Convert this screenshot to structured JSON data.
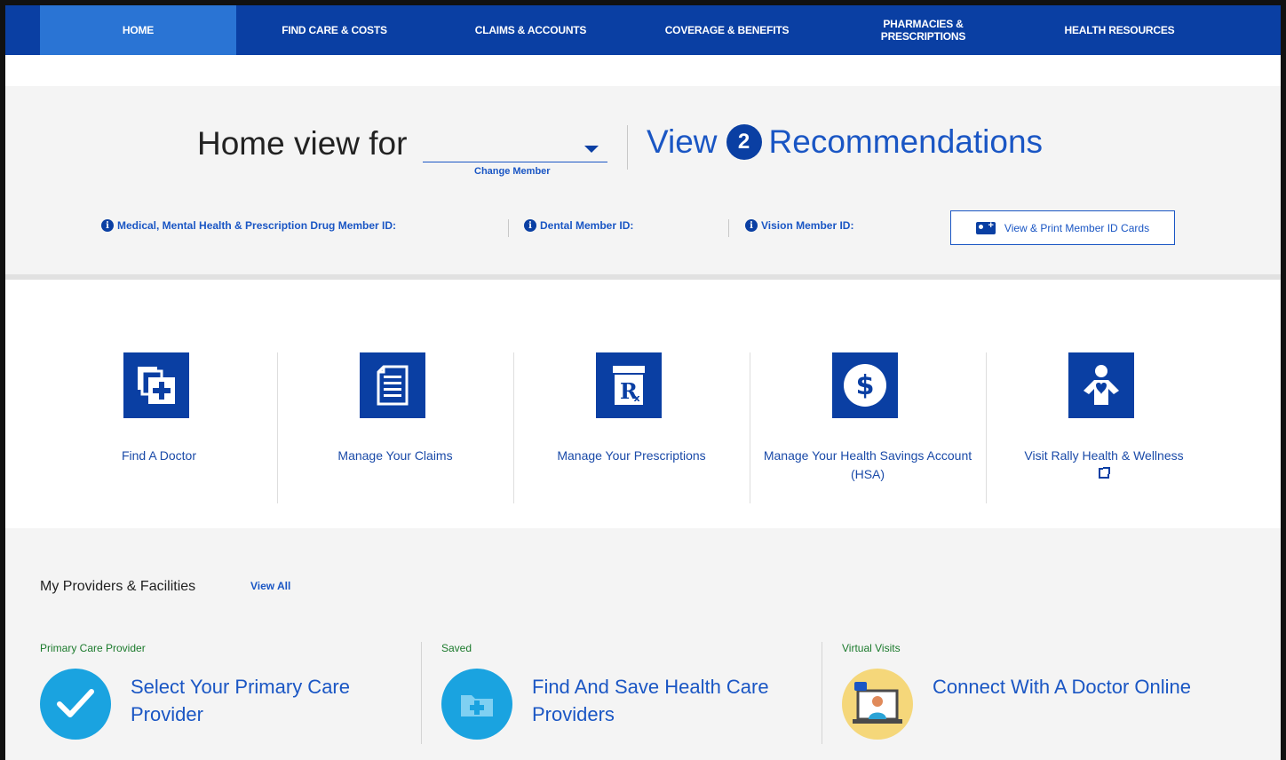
{
  "nav": {
    "items": [
      {
        "label": "HOME",
        "active": true
      },
      {
        "label": "FIND CARE & COSTS"
      },
      {
        "label": "CLAIMS & ACCOUNTS"
      },
      {
        "label": "COVERAGE & BENEFITS"
      },
      {
        "label": "PHARMACIES & PRESCRIPTIONS"
      },
      {
        "label": "HEALTH RESOURCES"
      }
    ]
  },
  "member": {
    "home_view_label": "Home view for",
    "selected_member": "",
    "change_member": "Change Member",
    "recs_prefix": "View",
    "recs_count": "2",
    "recs_suffix": "Recommendations",
    "ids": [
      {
        "label": "Medical, Mental Health & Prescription Drug Member ID:"
      },
      {
        "label": "Dental Member ID:"
      },
      {
        "label": "Vision Member ID:"
      }
    ],
    "print_cards_label": "View & Print Member ID Cards"
  },
  "quick_links": [
    {
      "label": "Find A Doctor",
      "icon": "find-doctor-icon"
    },
    {
      "label": "Manage Your Claims",
      "icon": "claims-document-icon"
    },
    {
      "label": "Manage Your Prescriptions",
      "icon": "rx-bottle-icon"
    },
    {
      "label": "Manage Your Health Savings Account (HSA)",
      "icon": "dollar-icon"
    },
    {
      "label": "Visit Rally Health & Wellness",
      "icon": "wellness-person-icon",
      "external": true
    }
  ],
  "providers": {
    "title": "My Providers & Facilities",
    "view_all": "View All",
    "columns": [
      {
        "category": "Primary Care Provider",
        "link": "Select Your Primary Care Provider",
        "icon": "checkmark-icon",
        "color": "#1aa3e0"
      },
      {
        "category": "Saved",
        "link": "Find And Save Health Care Providers",
        "icon": "folder-plus-icon",
        "color": "#1aa3e0"
      },
      {
        "category": "Virtual Visits",
        "link": "Connect With A Doctor Online",
        "icon": "virtual-doctor-icon",
        "color": "#f5d77a"
      }
    ]
  },
  "colors": {
    "nav_bg": "#0a3fa3",
    "nav_active": "#2a74d4",
    "link_blue": "#1a56c4",
    "category_green": "#1b7a2c"
  }
}
